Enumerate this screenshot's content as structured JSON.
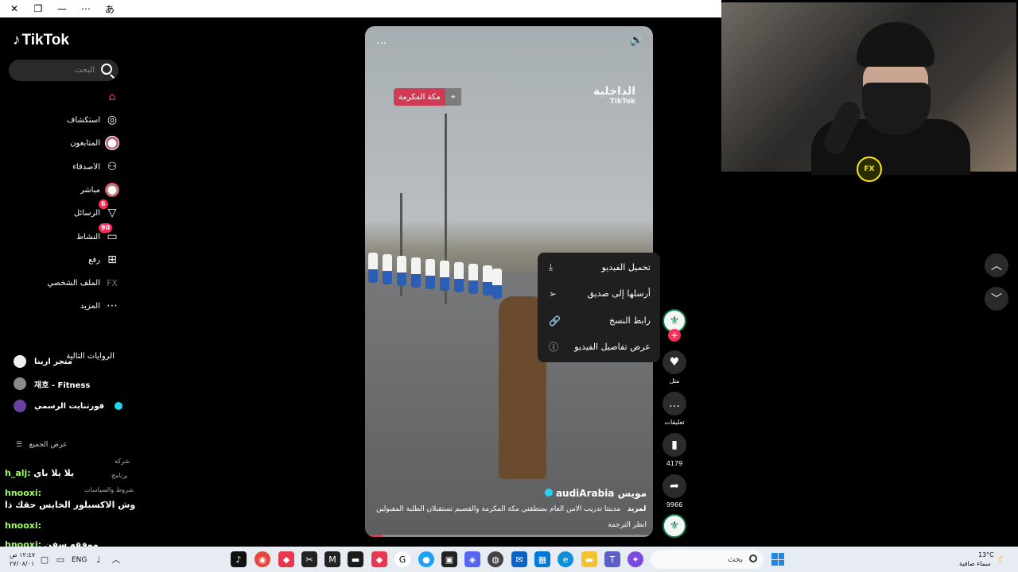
{
  "window": {
    "title_icons": [
      "close-icon",
      "restore-icon",
      "minimize-icon",
      "more-icon",
      "translate-icon"
    ]
  },
  "sidebar": {
    "logo": "TikTok",
    "search_placeholder": "البحث",
    "nav": [
      {
        "label": "",
        "icon": "home-icon"
      },
      {
        "label": "استكشاف",
        "icon": "compass-icon"
      },
      {
        "label": "المتابعون",
        "icon": "avatar-icon"
      },
      {
        "label": "الأصدقاء",
        "icon": "friends-icon"
      },
      {
        "label": "مباشر",
        "icon": "live-avatar-icon"
      },
      {
        "label": "الرسائل",
        "icon": "send-icon",
        "badge": "6"
      },
      {
        "label": "النشاط",
        "icon": "activity-icon",
        "badge": "90"
      },
      {
        "label": "رفع",
        "icon": "upload-icon"
      },
      {
        "label": "الملف الشخصي",
        "icon": "profile-icon"
      },
      {
        "label": "المزيد",
        "icon": "more-dots-icon"
      }
    ],
    "following_title": "الروايات التالية",
    "accounts": [
      {
        "name": "متجر ارينا"
      },
      {
        "name": "재호 - Fitness"
      },
      {
        "name": "فورتنايت الرسمي"
      }
    ],
    "see_all": "عرض الجميع",
    "tiny_labels": [
      "شركة",
      "برنامج",
      "شروط والسياسات"
    ]
  },
  "chat": [
    {
      "user": "h_alj:",
      "msg": "يلا يلا باي"
    },
    {
      "user": "hnooxi:",
      "msg": "وش الاكسبلور الخايس حقك ذا"
    },
    {
      "user": "hnooxi:",
      "msg": ""
    },
    {
      "user": "hnooxi:",
      "msg": "موفقه سفن"
    }
  ],
  "video": {
    "location": "مكة المكرمة",
    "watermark": "الداخلية",
    "watermark_sub": "TikTok",
    "username": "audiArabia مويس",
    "caption": "مدينتا تدريب الأمن العام بمنطقتي مكة المكرمة والقصيم تستقبلان الطلبة المقبولين",
    "more": "المزيد",
    "translate": "انظر الترجمة",
    "more_icon": "...",
    "sound_icon": "🔊",
    "progress": 0.06
  },
  "context_menu": {
    "items": [
      {
        "label": "تحميل الفيديو",
        "icon": "⤓"
      },
      {
        "label": "أرسلها إلى صديق",
        "icon": "➢"
      },
      {
        "label": "رابط النسخ",
        "icon": "🔗"
      },
      {
        "label": "عرض تفاصيل الفيديو",
        "icon": "ⓘ"
      }
    ]
  },
  "rail": {
    "like_label": "مثل",
    "comment_label": "تعليقات",
    "bookmark_count": "4179",
    "share_count": "9966"
  },
  "webcam": {
    "logo": "FX"
  },
  "taskbar": {
    "search_text": "بحث",
    "language": "ENG",
    "time": "١٢:٤٧ ص",
    "date": "٢٧/٠٨/٠١",
    "weather_temp": "13°C",
    "weather_desc": "سماء صافية"
  }
}
